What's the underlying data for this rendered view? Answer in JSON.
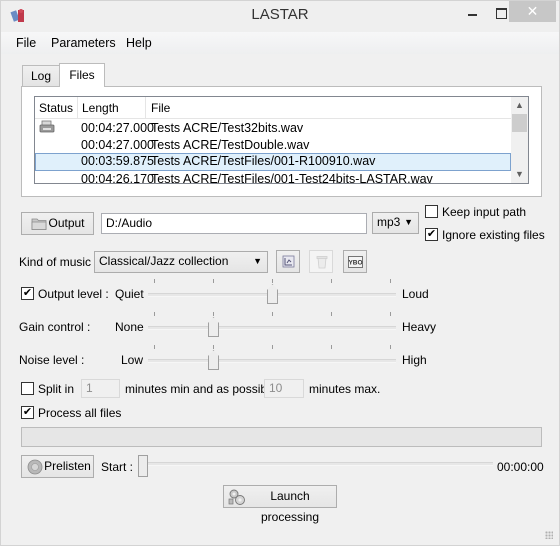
{
  "window": {
    "title": "LASTAR",
    "controls": {
      "minimize": "minimize",
      "maximize": "maximize",
      "close": "✕"
    }
  },
  "menu": [
    "File",
    "Parameters",
    "Help"
  ],
  "tabs": [
    {
      "label": "Log",
      "active": false
    },
    {
      "label": "Files",
      "active": true
    }
  ],
  "file_list": {
    "columns": [
      "Status",
      "Length",
      "File"
    ],
    "rows": [
      {
        "status_icon": "printer-icon",
        "length": "00:04:27.000",
        "file": "Tests ACRE/Test32bits.wav",
        "selected": false
      },
      {
        "status_icon": "",
        "length": "00:04:27.000",
        "file": "Tests ACRE/TestDouble.wav",
        "selected": false
      },
      {
        "status_icon": "",
        "length": "00:03:59.875",
        "file": "Tests ACRE/TestFiles/001-R100910.wav",
        "selected": true
      },
      {
        "status_icon": "",
        "length": "00:04:26.170",
        "file": "Tests ACRE/TestFiles/001-Test24bits-LASTAR.wav",
        "selected": false
      }
    ],
    "scroll": {
      "up": "^",
      "down": "v"
    }
  },
  "output": {
    "button_label": "Output",
    "path": "D:/Audio",
    "format": "mp3",
    "keep_input_path": {
      "label": "Keep input path",
      "checked": false
    },
    "ignore_existing": {
      "label": "Ignore existing files",
      "checked": true
    }
  },
  "music": {
    "label": "Kind of music :",
    "selected": "Classical/Jazz collection",
    "icon_buttons": [
      {
        "name": "edit-preset-icon",
        "enabled": true
      },
      {
        "name": "delete-preset-icon",
        "enabled": false
      },
      {
        "name": "save-preset-icon",
        "enabled": true
      }
    ]
  },
  "sliders": [
    {
      "id": "output-level",
      "label": "Output level :",
      "checkbox": true,
      "checked": true,
      "min_label": "Quiet",
      "max_label": "Loud",
      "value": 2,
      "max": 4
    },
    {
      "id": "gain-control",
      "label": "Gain control :",
      "checkbox": false,
      "min_label": "None",
      "max_label": "Heavy",
      "value": 1,
      "max": 4
    },
    {
      "id": "noise-level",
      "label": "Noise level :",
      "checkbox": false,
      "min_label": "Low",
      "max_label": "High",
      "value": 1,
      "max": 4
    }
  ],
  "split": {
    "label": "Split in",
    "checked": false,
    "min_value": "1",
    "middle_text": "minutes min and as possible",
    "max_value": "10",
    "end_text": "minutes max."
  },
  "process_all": {
    "label": "Process all files",
    "checked": true
  },
  "progress": {
    "value_percent": 0
  },
  "prelisten": {
    "button_label": "Prelisten",
    "start_label": "Start :",
    "position_percent": 0,
    "time": "00:00:00"
  },
  "launch": {
    "button_label": "Launch processing"
  }
}
